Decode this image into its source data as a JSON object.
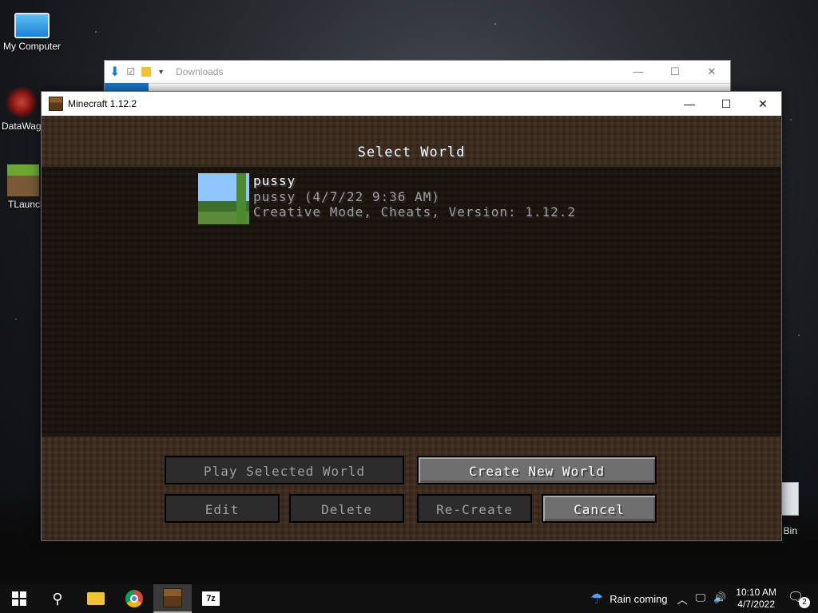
{
  "desktop": {
    "icons": [
      {
        "label": "My Computer"
      },
      {
        "label": "DataWag"
      },
      {
        "label": "TLaunch"
      }
    ],
    "recycle_bin_label": "le Bin"
  },
  "explorer": {
    "title": "Downloads",
    "minimize": "—",
    "maximize": "☐",
    "close": "✕"
  },
  "minecraft_window": {
    "title": "Minecraft 1.12.2",
    "minimize": "—",
    "maximize": "☐",
    "close": "✕",
    "screen_title": "Select World",
    "worlds": [
      {
        "name": "pussy",
        "folder_and_date": "pussy (4/7/22 9:36 AM)",
        "details": "Creative Mode, Cheats, Version: 1.12.2"
      }
    ],
    "buttons": {
      "play_selected": "Play Selected World",
      "create_new": "Create New World",
      "edit": "Edit",
      "delete": "Delete",
      "recreate": "Re-Create",
      "cancel": "Cancel"
    }
  },
  "taskbar": {
    "weather": "Rain coming",
    "time": "10:10 AM",
    "date": "4/7/2022",
    "notification_count": "2",
    "sevenzip_label": "7z"
  }
}
